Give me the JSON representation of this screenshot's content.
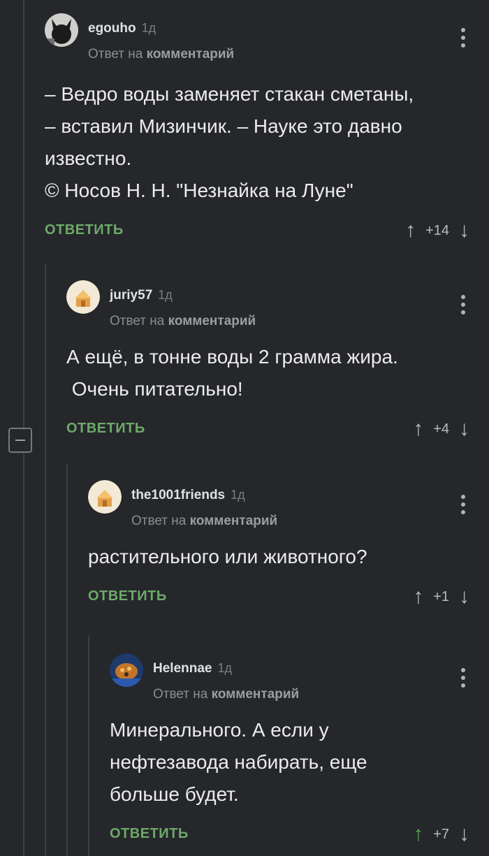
{
  "comments": [
    {
      "author": "egouho",
      "age": "1д",
      "reply_prefix": "Ответ на",
      "reply_target": "комментарий",
      "text_lines": [
        "– Ведро воды заменяет стакан сметаны,",
        "– вставил Мизинчик. – Науке это давно",
        "известно.",
        "© Носов Н. Н. \"Незнайка на Луне\""
      ],
      "reply_label": "ОТВЕТИТЬ",
      "score": "+14"
    },
    {
      "author": "juriy57",
      "age": "1д",
      "reply_prefix": "Ответ на",
      "reply_target": "комментарий",
      "text_lines": [
        "А ещё, в тонне воды 2 грамма жира.",
        " Очень питательно!"
      ],
      "reply_label": "ОТВЕТИТЬ",
      "score": "+4"
    },
    {
      "author": "the1001friends",
      "age": "1д",
      "reply_prefix": "Ответ на",
      "reply_target": "комментарий",
      "text_lines": [
        "растительного или животного?"
      ],
      "reply_label": "ОТВЕТИТЬ",
      "score": "+1"
    },
    {
      "author": "Helennae",
      "age": "1д",
      "reply_prefix": "Ответ на",
      "reply_target": "комментарий",
      "text_lines": [
        "Минерального. А если у",
        "нефтезавода набирать, еще",
        "больше будет."
      ],
      "reply_label": "ОТВЕТИТЬ",
      "score": "+7"
    }
  ],
  "icons": {
    "upvote": "arrow-up-icon",
    "downvote": "arrow-down-icon",
    "menu": "more-vertical-icon",
    "collapse": "collapse-minus-icon"
  },
  "colors": {
    "background": "#25272a",
    "reply_link": "#6ea96a",
    "upvote_active": "#4fa84b"
  }
}
